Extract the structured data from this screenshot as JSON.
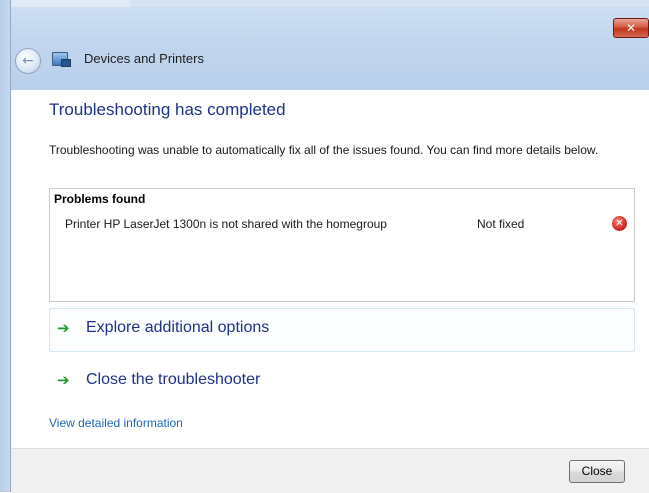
{
  "window": {
    "title": "Devices and Printers",
    "close_glyph": "✕"
  },
  "nav": {
    "back_glyph": "←"
  },
  "main": {
    "heading": "Troubleshooting has completed",
    "description": "Troubleshooting was unable to automatically fix all of the issues found. You can find more details below.",
    "problems": {
      "title": "Problems found",
      "items": [
        {
          "name": "Printer HP LaserJet 1300n is not shared with the homegroup",
          "status": "Not fixed",
          "icon": "error-icon"
        }
      ]
    },
    "options": [
      {
        "label": "Explore additional options",
        "icon": "green-arrow-icon"
      },
      {
        "label": "Close the troubleshooter",
        "icon": "green-arrow-icon"
      }
    ],
    "detail_link": "View detailed information"
  },
  "footer": {
    "close_label": "Close"
  },
  "colors": {
    "heading": "#1e3287",
    "link": "#1e66b8",
    "arrow": "#1e9a2a",
    "error": "#d8312b"
  }
}
